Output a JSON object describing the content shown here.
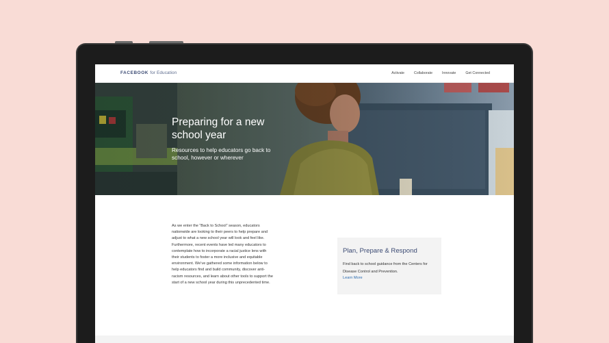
{
  "brand": {
    "name": "FACEBOOK",
    "suffix": "for Education"
  },
  "nav": {
    "links": [
      {
        "label": "Activate"
      },
      {
        "label": "Collaborate"
      },
      {
        "label": "Innovate"
      },
      {
        "label": "Get Connected"
      }
    ]
  },
  "hero": {
    "title": "Preparing for a new school year",
    "subtitle": "Resources to help educators go back to school, however or wherever"
  },
  "intro": {
    "text": "As we enter the “Back to School” season, educators nationwide are looking to their peers to help prepare and adjust to what a new school year will look and feel like. Furthermore, recent events have led many educators to contemplate how to incorporate a racial justice lens with their students to foster a more inclusive and equitable environment. We’ve gathered some information below to help educators find and build community, discover anti-racism resources, and learn about other tools to support the start of a new school year during this unprecedented time."
  },
  "card": {
    "title": "Plan, Prepare & Respond",
    "text": "Find back to school guidance from the Centers for Disease Control and Prevention.",
    "link": "Learn More"
  },
  "colors": {
    "background": "#f9dcd6",
    "brand": "#3b4a73",
    "link": "#2b6cb0",
    "card": "#f3f3f3"
  }
}
